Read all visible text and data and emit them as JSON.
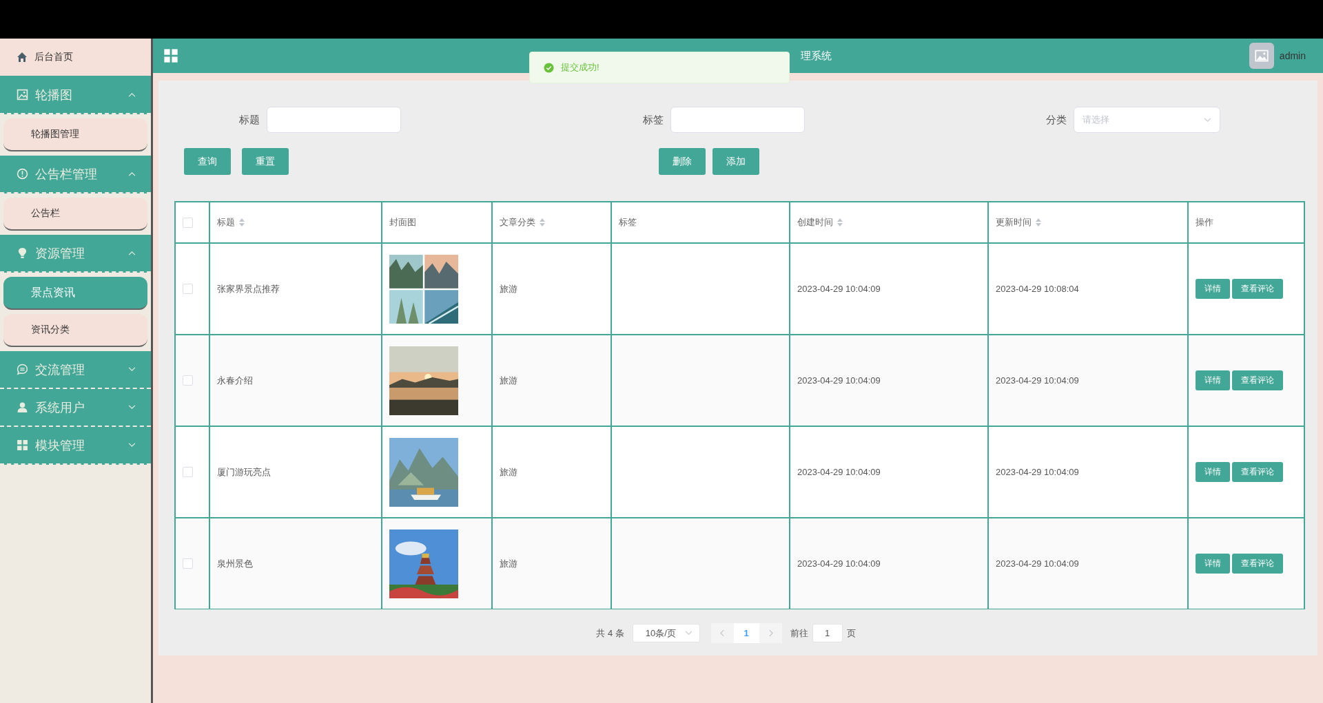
{
  "sidebar": {
    "items": [
      {
        "label": "后台首页",
        "kind": "home"
      },
      {
        "label": "轮播图",
        "kind": "group",
        "expanded": true,
        "children": [
          {
            "label": "轮播图管理",
            "selected": false
          }
        ]
      },
      {
        "label": "公告栏管理",
        "kind": "group",
        "expanded": true,
        "children": [
          {
            "label": "公告栏",
            "selected": false
          }
        ]
      },
      {
        "label": "资源管理",
        "kind": "group",
        "expanded": true,
        "children": [
          {
            "label": "景点资讯",
            "selected": true
          },
          {
            "label": "资讯分类",
            "selected": false
          }
        ]
      },
      {
        "label": "交流管理",
        "kind": "group",
        "expanded": false
      },
      {
        "label": "系统用户",
        "kind": "group",
        "expanded": false
      },
      {
        "label": "模块管理",
        "kind": "group",
        "expanded": false
      }
    ]
  },
  "header": {
    "title": "理系统",
    "user": "admin"
  },
  "toast": {
    "message": "提交成功!"
  },
  "search": {
    "fields": [
      {
        "label": "标题",
        "kind": "input"
      },
      {
        "label": "标签",
        "kind": "input"
      },
      {
        "label": "分类",
        "kind": "select",
        "placeholder": "请选择"
      }
    ],
    "left_buttons": [
      "查询",
      "重置"
    ],
    "right_buttons": [
      "删除",
      "添加"
    ]
  },
  "table": {
    "all_checked": false,
    "columns": [
      {
        "label": "标题",
        "sortable": true
      },
      {
        "label": "封面图",
        "sortable": false
      },
      {
        "label": "文章分类",
        "sortable": true
      },
      {
        "label": "标签",
        "sortable": false
      },
      {
        "label": "创建时间",
        "sortable": true
      },
      {
        "label": "更新时间",
        "sortable": true
      },
      {
        "label": "操作",
        "sortable": false
      }
    ],
    "rows": [
      {
        "checked": false,
        "title": "张家界景点推荐",
        "cover": {
          "kind": "picture"
        },
        "category": "旅游",
        "created": "2023-04-29 10:04:09",
        "updated": "2023-04-29 10:08:04",
        "actions": [
          "详情",
          "查看评论"
        ]
      },
      {
        "checked": false,
        "title": "永春介绍",
        "cover": {
          "kind": "picture"
        },
        "category": "旅游",
        "created": "2023-04-29 10:04:09",
        "updated": "2023-04-29 10:04:09",
        "actions": [
          "详情",
          "查看评论"
        ]
      },
      {
        "checked": false,
        "title": "厦门游玩亮点",
        "cover": {
          "kind": "picture"
        },
        "category": "旅游",
        "created": "2023-04-29 10:04:09",
        "updated": "2023-04-29 10:04:09",
        "actions": [
          "详情",
          "查看评论"
        ]
      },
      {
        "checked": false,
        "title": "泉州景色",
        "cover": {
          "kind": "picture"
        },
        "category": "旅游",
        "created": "2023-04-29 10:04:09",
        "updated": "2023-04-29 10:04:09",
        "actions": [
          "详情",
          "查看评论"
        ]
      }
    ]
  },
  "pagination": {
    "total": "共 4 条",
    "page_size": "10条/页",
    "pages": [
      {
        "label": "1",
        "selected": true
      }
    ],
    "goto_label": "前往",
    "goto_value": "1",
    "page_suffix": "页"
  }
}
